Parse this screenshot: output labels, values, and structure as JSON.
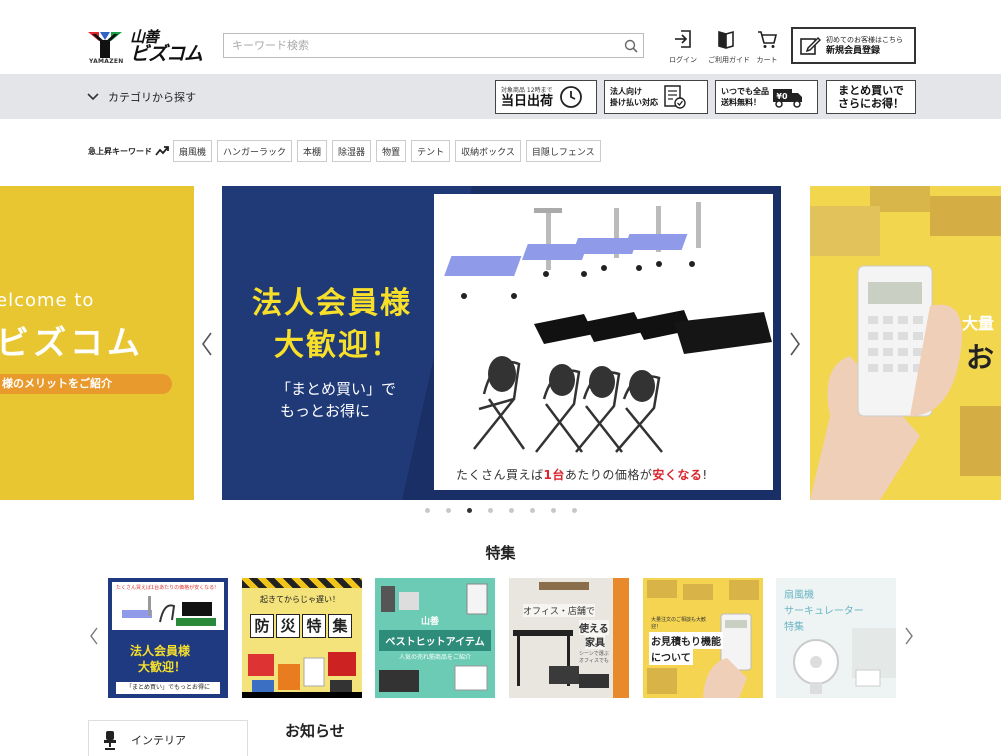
{
  "header": {
    "logo_text_1": "山善",
    "logo_text_2": "ビズコム",
    "logo_sub": "YAMAZEN",
    "search_placeholder": "キーワード検索",
    "login": "ログイン",
    "guide": "ご利用ガイド",
    "cart": "カート",
    "register_small": "初めてのお客様はこちら",
    "register_big": "新規会員登録"
  },
  "navbar": {
    "category": "カテゴリから探す",
    "promos": [
      {
        "line1": "対象商品 12時まで",
        "line2": "当日出荷"
      },
      {
        "line1": "法人向け",
        "line2": "掛け払い対応"
      },
      {
        "line1": "いつでも全品",
        "line2": "送料無料！",
        "badge": "¥0"
      },
      {
        "line1": "まとめ買いで",
        "line2": "さらにお得！"
      }
    ]
  },
  "trending": {
    "label": "急上昇キーワード",
    "tags": [
      "扇風機",
      "ハンガーラック",
      "本棚",
      "除湿器",
      "物置",
      "テント",
      "収納ボックス",
      "目隠しフェンス"
    ]
  },
  "carousel": {
    "left": {
      "line1": "elcome to",
      "line2": "ビズコム",
      "line3": "様のメリットをご紹介"
    },
    "main": {
      "title1": "法人会員様",
      "title2": "大歓迎！",
      "sub1": "「まとめ買い」で",
      "sub2": "もっとお得に",
      "caption_a": "たくさん買えば",
      "caption_b": "1台",
      "caption_c": "あたりの価格が",
      "caption_d": "安くなる",
      "caption_e": "!"
    },
    "right": {
      "text1": "大量",
      "text2": "お"
    },
    "dot_count": 8,
    "active_dot": 2
  },
  "features": {
    "title": "特集",
    "items": [
      {
        "top": "たくさん買えば1台あたりの価格が安くなる!",
        "line1": "法人会員様",
        "line2": "大歓迎！",
        "line3": "「まとめ買い」でもっとお得に"
      },
      {
        "top": "起きてからじゃ遅い！",
        "chars": [
          "防",
          "災",
          "特",
          "集"
        ]
      },
      {
        "line1": "山善",
        "line2": "ベストヒットアイテム",
        "line3": "人気の売れ筋商品をご紹介"
      },
      {
        "line1": "オフィス・店舗で",
        "line2": "使える",
        "line3": "家具",
        "line4": "シーンで選ぶ オフィスでも"
      },
      {
        "top": "大量注文のご相談も大歓迎！",
        "line1": "お見積もり機能",
        "line2": "について"
      },
      {
        "line1": "扇風機",
        "line2": "サーキュレーター",
        "line3": "特集"
      }
    ]
  },
  "bottom": {
    "sidebar_first": "インテリア",
    "news_title": "お知らせ"
  }
}
